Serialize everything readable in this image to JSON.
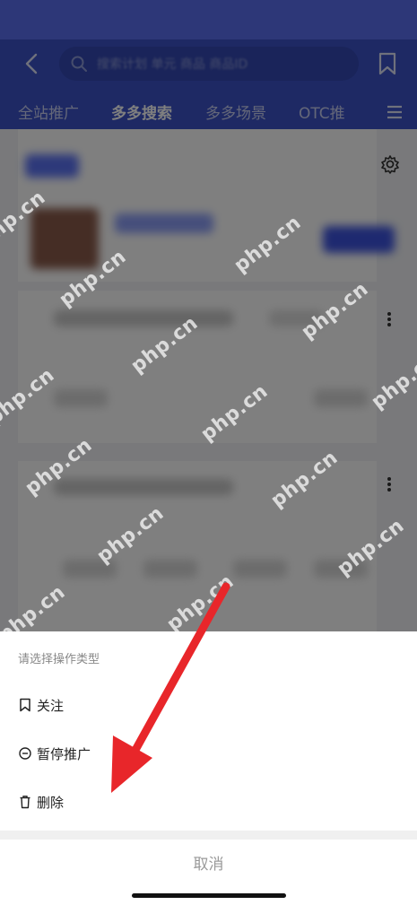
{
  "status_bar": {
    "color": "#5a6ff0"
  },
  "header": {
    "search_placeholder": "搜索计划 单元 商品 商品ID",
    "tabs": [
      {
        "label": "全站推广",
        "active": false
      },
      {
        "label": "多多搜索",
        "active": true
      },
      {
        "label": "多多场景",
        "active": false
      },
      {
        "label": "OTC推",
        "active": false
      }
    ],
    "colors": {
      "header": "#3c53c8",
      "search_box": "#3448b4"
    }
  },
  "watermark": {
    "text": "php.cn"
  },
  "action_sheet": {
    "title": "请选择操作类型",
    "options": [
      {
        "label": "关注",
        "icon": "bookmark-icon"
      },
      {
        "label": "暂停推广",
        "icon": "pause-circle-icon"
      },
      {
        "label": "删除",
        "icon": "trash-icon"
      }
    ],
    "cancel_label": "取消"
  },
  "annotation": {
    "arrow_color": "#e8262a"
  }
}
